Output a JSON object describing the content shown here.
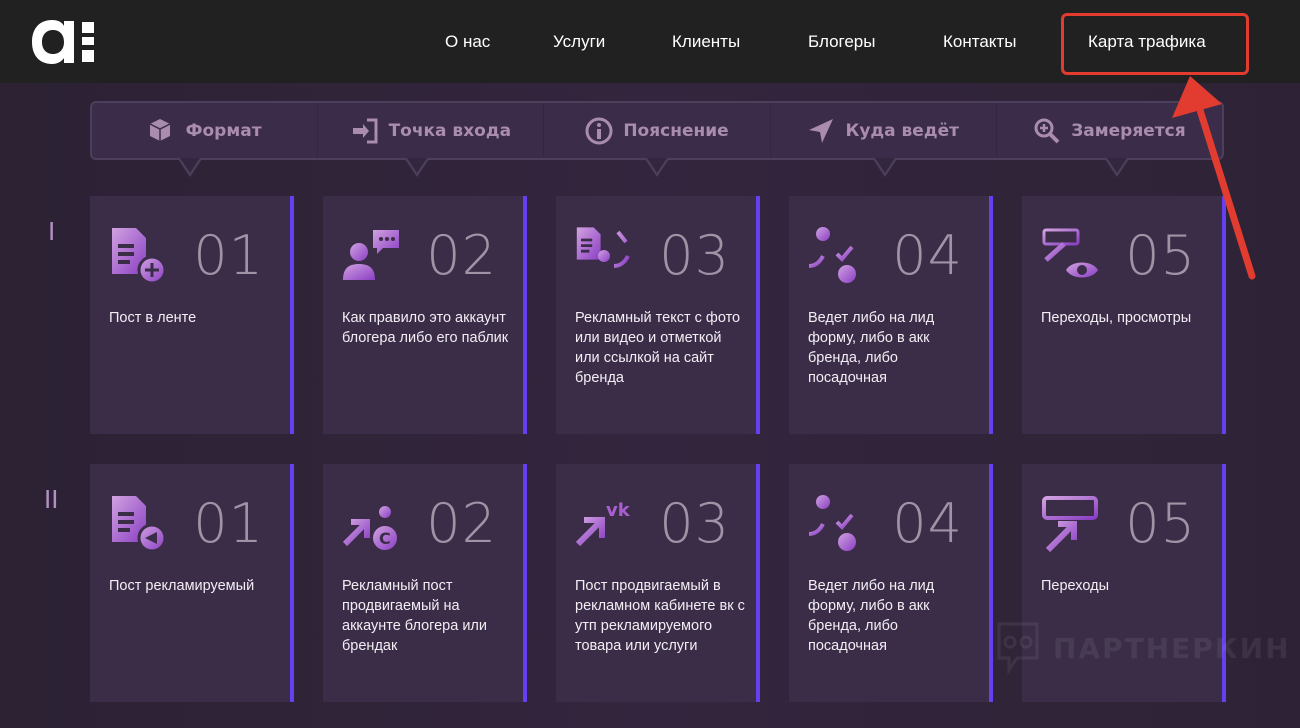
{
  "header": {
    "logo_text": "a:",
    "nav": [
      "О нас",
      "Услуги",
      "Клиенты",
      "Блогеры",
      "Контакты",
      "Карта трафика"
    ],
    "highlighted": "Карта трафика"
  },
  "tabs": [
    {
      "label": "Формат",
      "icon": "package-icon"
    },
    {
      "label": "Точка входа",
      "icon": "sign-in-icon"
    },
    {
      "label": "Пояснение",
      "icon": "info-icon"
    },
    {
      "label": "Куда ведёт",
      "icon": "location-arrow-icon"
    },
    {
      "label": "Замеряется",
      "icon": "zoom-in-icon"
    }
  ],
  "rows": [
    {
      "label": "I",
      "cards": [
        {
          "num": "01",
          "text": "Пост в ленте",
          "icon": "document-plus-icon"
        },
        {
          "num": "02",
          "text": "Как правило это аккаунт блогера либо его паблик",
          "icon": "user-chat-icon"
        },
        {
          "num": "03",
          "text": "Рекламный текст с фото или видео и отметкой или ссылкой на сайт бренда",
          "icon": "document-media-link-icon"
        },
        {
          "num": "04",
          "text": "Ведет либо на лид форму, либо в акк бренда, либо посадочная",
          "icon": "brand-globe-icon"
        },
        {
          "num": "05",
          "text": "Переходы, просмотры",
          "icon": "click-eye-icon"
        }
      ]
    },
    {
      "label": "II",
      "cards": [
        {
          "num": "01",
          "text": "Пост рекламируемый",
          "icon": "document-megaphone-icon"
        },
        {
          "num": "02",
          "text": "Рекламный пост продвигаемый на аккаунте блогера или брендак",
          "icon": "arrow-user-brand-icon"
        },
        {
          "num": "03",
          "text": "Пост продвигаемый в рекламном кабинете вк с утп рекламируемого товара или услуги",
          "icon": "arrow-vk-icon"
        },
        {
          "num": "04",
          "text": "Ведет либо на лид форму, либо в акк бренда, либо посадочная",
          "icon": "brand-globe-icon"
        },
        {
          "num": "05",
          "text": "Переходы",
          "icon": "click-icon"
        }
      ]
    }
  ],
  "watermark": "ПАРТНЕРКИН",
  "colors": {
    "accent": "#6540f0",
    "highlight": "#e23b30",
    "icon": "#a95fd0"
  }
}
